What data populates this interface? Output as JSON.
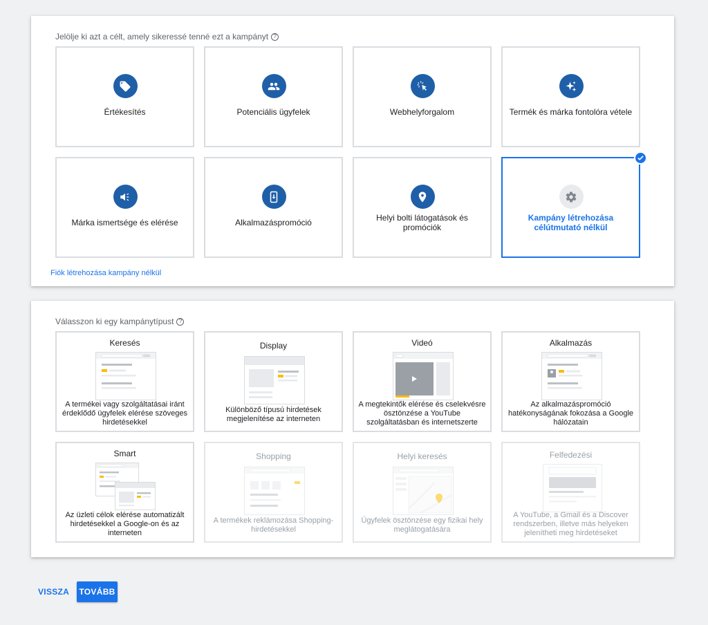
{
  "goals": {
    "title": "Jelölje ki azt a célt, amely sikeressé tenné ezt a kampányt",
    "items": [
      {
        "label": "Értékesítés",
        "icon": "tag-icon"
      },
      {
        "label": "Potenciális ügyfelek",
        "icon": "people-icon"
      },
      {
        "label": "Webhelyforgalom",
        "icon": "cursor-click-icon"
      },
      {
        "label": "Termék és márka fontolóra vétele",
        "icon": "sparkle-icon"
      },
      {
        "label": "Márka ismertsége és elérése",
        "icon": "megaphone-icon"
      },
      {
        "label": "Alkalmazáspromóció",
        "icon": "phone-download-icon"
      },
      {
        "label": "Helyi bolti látogatások és promóciók",
        "icon": "location-pin-icon"
      },
      {
        "label": "Kampány létrehozása célútmutató nélkül",
        "icon": "gear-icon",
        "selected": true
      }
    ],
    "account_link": "Fiók létrehozása kampány nélkül"
  },
  "types": {
    "title": "Válasszon ki egy kampánytípust",
    "items": [
      {
        "title": "Keresés",
        "desc": "A termékei vagy szolgáltatásai iránt érdeklődő ügyfelek elérése szöveges hirdetésekkel"
      },
      {
        "title": "Display",
        "desc": "Különböző típusú hirdetések megjelenítése az interneten"
      },
      {
        "title": "Videó",
        "desc": "A megtekintők elérése és cselekvésre ösztönzése a YouTube szolgáltatásban és internetszerte"
      },
      {
        "title": "Alkalmazás",
        "desc": "Az alkalmazáspromóció hatékonyságának fokozása a Google hálózatain"
      },
      {
        "title": "Smart",
        "desc": "Az üzleti célok elérése automatizált hirdetésekkel a Google-on és az interneten"
      },
      {
        "title": "Shopping",
        "desc": "A termékek reklámozása Shopping-hirdetésekkel",
        "disabled": true
      },
      {
        "title": "Helyi keresés",
        "desc": "Ügyfelek ösztönzése egy fizikai hely meglátogatására",
        "disabled": true
      },
      {
        "title": "Felfedezési",
        "desc": "A YouTube, a Gmail és a Discover rendszerben, illetve más helyeken jelenítheti meg hirdetéseket",
        "disabled": true
      }
    ]
  },
  "footer": {
    "back": "VISSZA",
    "next": "TOVÁBB"
  },
  "colors": {
    "accent": "#1a73e8",
    "icon_bg": "#1f5fa8",
    "yellow": "#fbbc04"
  }
}
